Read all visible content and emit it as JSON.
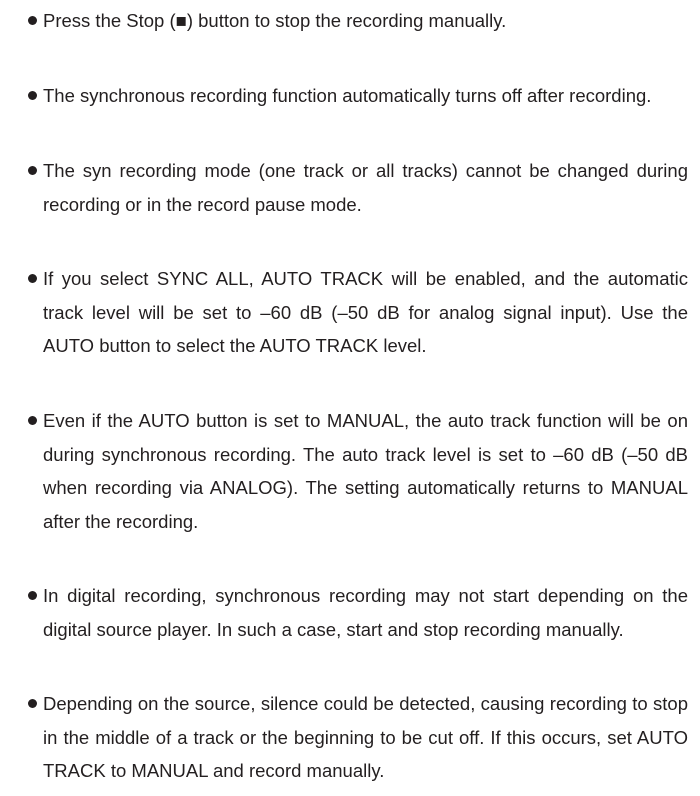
{
  "notes": [
    "Press the Stop (■) button to stop the recording manually.",
    "The synchronous recording function automatically turns off after recording.",
    "The syn recording mode (one track or all tracks) cannot be changed during recording or in the record pause mode.",
    "If you select SYNC ALL, AUTO TRACK will be enabled, and the automatic track level will be set to –60 dB (–50 dB for analog signal input). Use the AUTO button to select the AUTO TRACK level.",
    "Even if the AUTO button is set to MANUAL, the auto track function will be on during synchronous recording. The auto track level is set to –60 dB (–50 dB when recording via ANALOG). The setting automatically returns to MANUAL after the recording.",
    "In digital recording, synchronous recording may not start depending on the digital source player. In such a case, start and stop recording manually.",
    "Depending on the source, silence could be detected, causing recording to stop in the middle of a track or the beginning to be cut off. If this occurs, set AUTO TRACK  to MANUAL and record manually."
  ]
}
